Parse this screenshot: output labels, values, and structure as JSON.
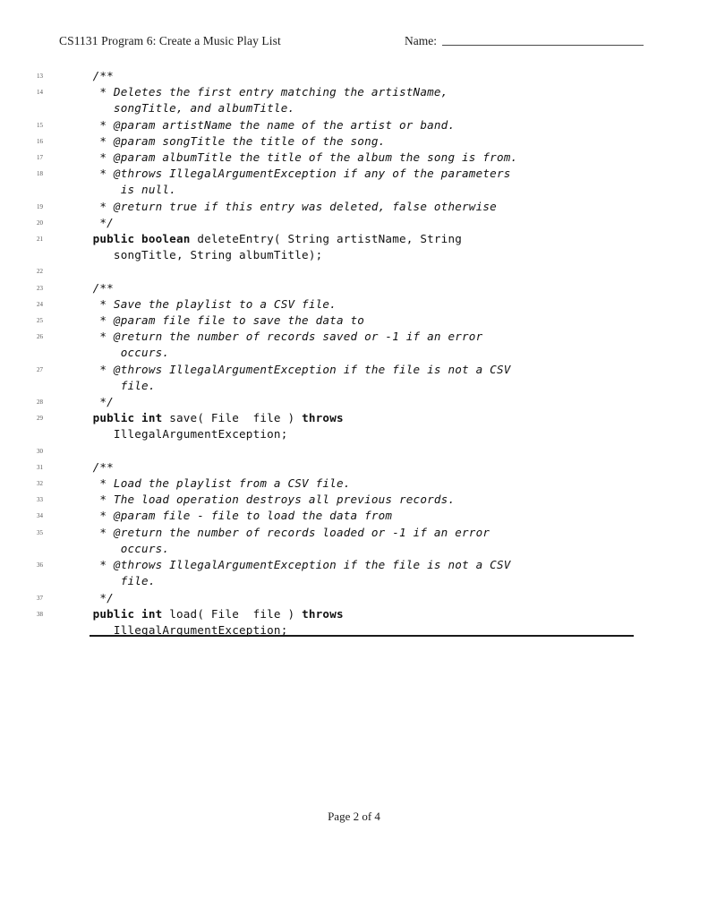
{
  "document": {
    "header": {
      "title": "CS1131 Program 6: Create a Music Play List",
      "name_label": "Name:"
    },
    "footer": {
      "page_text": "Page 2 of 4"
    },
    "colors": {
      "text": "#111111",
      "lineno": "#555555",
      "rule": "#1a1a1a",
      "page_background": "#ffffff"
    },
    "code_lines": [
      {
        "number": "13",
        "segments": [
          {
            "text": "  /**",
            "style": "comment"
          }
        ]
      },
      {
        "number": "14",
        "segments": [
          {
            "text": "   * Deletes the first entry matching the artistName,\n     songTitle, and albumTitle.",
            "style": "comment"
          }
        ]
      },
      {
        "number": "15",
        "segments": [
          {
            "text": "   * @param artistName the name of the artist or band.",
            "style": "comment"
          }
        ]
      },
      {
        "number": "16",
        "segments": [
          {
            "text": "   * @param songTitle the title of the song.",
            "style": "comment"
          }
        ]
      },
      {
        "number": "17",
        "segments": [
          {
            "text": "   * @param albumTitle the title of the album the song is from.",
            "style": "comment"
          }
        ]
      },
      {
        "number": "18",
        "segments": [
          {
            "text": "   * @throws IllegalArgumentException if any of the parameters\n      is null.",
            "style": "comment"
          }
        ]
      },
      {
        "number": "19",
        "segments": [
          {
            "text": "   * @return true if this entry was deleted, false otherwise",
            "style": "comment"
          }
        ]
      },
      {
        "number": "20",
        "segments": [
          {
            "text": "   */",
            "style": "comment"
          }
        ]
      },
      {
        "number": "21",
        "segments": [
          {
            "text": "  ",
            "style": "plain"
          },
          {
            "text": "public boolean",
            "style": "keyword"
          },
          {
            "text": " deleteEntry( String artistName, String\n     songTitle, String albumTitle);",
            "style": "plain"
          }
        ]
      },
      {
        "number": "22",
        "segments": [
          {
            "text": "",
            "style": "plain"
          }
        ]
      },
      {
        "number": "23",
        "segments": [
          {
            "text": "  /**",
            "style": "comment"
          }
        ]
      },
      {
        "number": "24",
        "segments": [
          {
            "text": "   * Save the playlist to a CSV file.",
            "style": "comment"
          }
        ]
      },
      {
        "number": "25",
        "segments": [
          {
            "text": "   * @param file file to save the data to",
            "style": "comment"
          }
        ]
      },
      {
        "number": "26",
        "segments": [
          {
            "text": "   * @return the number of records saved or -1 if an error\n      occurs.",
            "style": "comment"
          }
        ]
      },
      {
        "number": "27",
        "segments": [
          {
            "text": "   * @throws IllegalArgumentException if the file is not a CSV\n      file.",
            "style": "comment"
          }
        ]
      },
      {
        "number": "28",
        "segments": [
          {
            "text": "   */",
            "style": "comment"
          }
        ]
      },
      {
        "number": "29",
        "segments": [
          {
            "text": "  ",
            "style": "plain"
          },
          {
            "text": "public int",
            "style": "keyword"
          },
          {
            "text": " save( File  file ) ",
            "style": "plain"
          },
          {
            "text": "throws",
            "style": "keyword"
          },
          {
            "text": "\n     IllegalArgumentException;",
            "style": "plain"
          }
        ]
      },
      {
        "number": "30",
        "segments": [
          {
            "text": "",
            "style": "plain"
          }
        ]
      },
      {
        "number": "31",
        "segments": [
          {
            "text": "  /**",
            "style": "comment"
          }
        ]
      },
      {
        "number": "32",
        "segments": [
          {
            "text": "   * Load the playlist from a CSV file.",
            "style": "comment"
          }
        ]
      },
      {
        "number": "33",
        "segments": [
          {
            "text": "   * The load operation destroys all previous records.",
            "style": "comment"
          }
        ]
      },
      {
        "number": "34",
        "segments": [
          {
            "text": "   * @param file - file to load the data from",
            "style": "comment"
          }
        ]
      },
      {
        "number": "35",
        "segments": [
          {
            "text": "   * @return the number of records loaded or -1 if an error\n      occurs.",
            "style": "comment"
          }
        ]
      },
      {
        "number": "36",
        "segments": [
          {
            "text": "   * @throws IllegalArgumentException if the file is not a CSV\n      file.",
            "style": "comment"
          }
        ]
      },
      {
        "number": "37",
        "segments": [
          {
            "text": "   */",
            "style": "comment"
          }
        ]
      },
      {
        "number": "38",
        "segments": [
          {
            "text": "  ",
            "style": "plain"
          },
          {
            "text": "public int",
            "style": "keyword"
          },
          {
            "text": " load( File  file ) ",
            "style": "plain"
          },
          {
            "text": "throws",
            "style": "keyword"
          },
          {
            "text": "\n     IllegalArgumentException;",
            "style": "plain"
          }
        ]
      }
    ]
  }
}
